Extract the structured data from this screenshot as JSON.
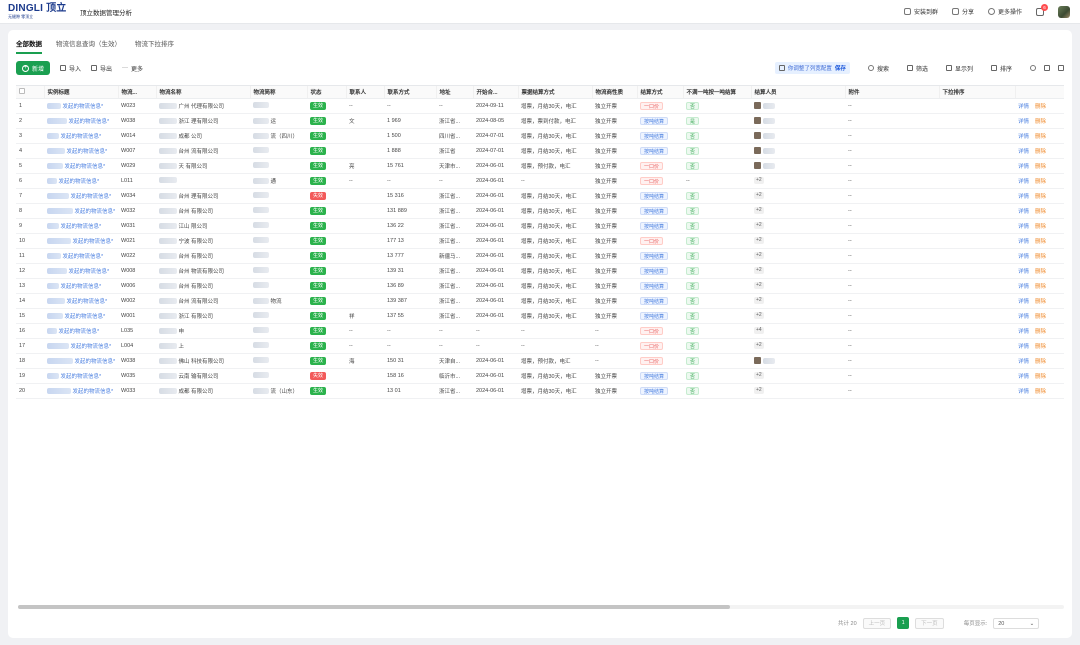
{
  "header": {
    "logo_text": "DINGLI 顶立",
    "logo_sub": "无缝隙  零顶立",
    "app_title": "顶立数据管理分析",
    "actions": [
      {
        "label": "安装到群",
        "icon": "group-install-icon"
      },
      {
        "label": "分享",
        "icon": "share-icon"
      },
      {
        "label": "更多操作",
        "icon": "more-ops-icon"
      }
    ],
    "notification_count": "6"
  },
  "tabs": [
    {
      "label": "全部数据",
      "active": true
    },
    {
      "label": "物流信息查询（生效）",
      "active": false
    },
    {
      "label": "物流下拉排序",
      "active": false
    }
  ],
  "toolbar": {
    "new_label": "新增",
    "import_label": "导入",
    "export_label": "导出",
    "more_label": "更多",
    "tip_text": "你调整了列宽配置",
    "tip_save": "保存",
    "search_label": "搜索",
    "filter_label": "筛选",
    "columns_label": "显示列",
    "sort_label": "排序"
  },
  "columns": [
    "实例标题",
    "物流...",
    "物流名称",
    "物流简称",
    "状态",
    "联系人",
    "联系方式",
    "地址",
    "开始合...",
    "票据结算方式",
    "物流商性质",
    "结算方式",
    "不满一吨按一吨结算",
    "结算人员",
    "附件",
    "下拉排序"
  ],
  "rows": [
    {
      "no": "1",
      "title": "发起的物流信息*",
      "code": "W023",
      "name": "广州  代理有限公司",
      "short": "",
      "status": "生效",
      "contact": "--",
      "phone": "--",
      "addr": "--",
      "start": "2024-09-11",
      "bill": "增票，月结30天，电汇",
      "nature": "独立开票",
      "settle": "一口价",
      "ton": "否",
      "people": "av2",
      "att": "--"
    },
    {
      "no": "2",
      "title": "发起的物流信息*",
      "code": "W038",
      "name": "浙江  理有限公司",
      "short": "运",
      "status": "生效",
      "contact": "文",
      "phone": "1  969",
      "addr": "浙江省...",
      "start": "2024-08-05",
      "bill": "增票，票到付款，电汇",
      "nature": "独立开票",
      "settle": "按吨结算",
      "ton": "是",
      "people": "av2",
      "att": "--"
    },
    {
      "no": "3",
      "title": "发起的物流信息*",
      "code": "W014",
      "name": "成都  公司",
      "short": "流（四川）",
      "status": "生效",
      "contact": "",
      "phone": "1  500",
      "addr": "四川省...",
      "start": "2024-07-01",
      "bill": "增票，月结30天，电汇",
      "nature": "独立开票",
      "settle": "按吨结算",
      "ton": "否",
      "people": "av2",
      "att": "--"
    },
    {
      "no": "4",
      "title": "发起的物流信息*",
      "code": "W007",
      "name": "台州  流有限公司",
      "short": "",
      "status": "生效",
      "contact": "",
      "phone": "1  888",
      "addr": "浙江省",
      "start": "2024-07-01",
      "bill": "增票，月结30天，电汇",
      "nature": "独立开票",
      "settle": "按吨结算",
      "ton": "否",
      "people": "av2",
      "att": "--"
    },
    {
      "no": "5",
      "title": "发起的物流信息*",
      "code": "W029",
      "name": "天  有限公司",
      "short": "",
      "status": "生效",
      "contact": "亮",
      "phone": "15  761",
      "addr": "天津市...",
      "start": "2024-06-01",
      "bill": "增票，预付款，电汇",
      "nature": "独立开票",
      "settle": "一口价",
      "ton": "否",
      "people": "av2",
      "att": "--"
    },
    {
      "no": "6",
      "title": "发起的物流信息*",
      "code": "L011",
      "name": "",
      "short": "通",
      "status": "生效",
      "contact": "--",
      "phone": "--",
      "addr": "--",
      "start": "2024-06-01",
      "bill": "--",
      "nature": "独立开票",
      "settle": "一口价",
      "ton": "--",
      "people": "+2",
      "att": "--"
    },
    {
      "no": "7",
      "title": "发起的物流信息*",
      "code": "W034",
      "name": "台州  理有限公司",
      "short": "",
      "status": "失效",
      "contact": "",
      "phone": "15  316",
      "addr": "浙江省...",
      "start": "2024-06-01",
      "bill": "增票，月结30天，电汇",
      "nature": "独立开票",
      "settle": "按吨结算",
      "ton": "否",
      "people": "+2",
      "att": "--"
    },
    {
      "no": "8",
      "title": "发起的物流信息*",
      "code": "W032",
      "name": "台州  有限公司",
      "short": "",
      "status": "生效",
      "contact": "",
      "phone": "131  889",
      "addr": "浙江省...",
      "start": "2024-06-01",
      "bill": "增票，月结30天，电汇",
      "nature": "独立开票",
      "settle": "按吨结算",
      "ton": "否",
      "people": "+2",
      "att": "--"
    },
    {
      "no": "9",
      "title": "发起的物流信息*",
      "code": "W031",
      "name": "江山  限公司",
      "short": "",
      "status": "生效",
      "contact": "",
      "phone": "136  22",
      "addr": "浙江省...",
      "start": "2024-06-01",
      "bill": "增票，月结30天，电汇",
      "nature": "独立开票",
      "settle": "按吨结算",
      "ton": "否",
      "people": "+2",
      "att": "--"
    },
    {
      "no": "10",
      "title": "发起的物流信息*",
      "code": "W021",
      "name": "宁波  有限公司",
      "short": "",
      "status": "生效",
      "contact": "",
      "phone": "177  13",
      "addr": "浙江省...",
      "start": "2024-06-01",
      "bill": "增票，月结30天，电汇",
      "nature": "独立开票",
      "settle": "一口价",
      "ton": "否",
      "people": "+2",
      "att": "--"
    },
    {
      "no": "11",
      "title": "发起的物流信息*",
      "code": "W022",
      "name": "台州  有限公司",
      "short": "",
      "status": "生效",
      "contact": "",
      "phone": "13  777",
      "addr": "新疆马...",
      "start": "2024-06-01",
      "bill": "增票，月结30天，电汇",
      "nature": "独立开票",
      "settle": "按吨结算",
      "ton": "否",
      "people": "+2",
      "att": "--"
    },
    {
      "no": "12",
      "title": "发起的物流信息*",
      "code": "W008",
      "name": "台州  物流有限公司",
      "short": "",
      "status": "生效",
      "contact": "",
      "phone": "139  31",
      "addr": "浙江省...",
      "start": "2024-06-01",
      "bill": "增票，月结30天，电汇",
      "nature": "独立开票",
      "settle": "按吨结算",
      "ton": "否",
      "people": "+2",
      "att": "--"
    },
    {
      "no": "13",
      "title": "发起的物流信息*",
      "code": "W006",
      "name": "台州  有限公司",
      "short": "",
      "status": "生效",
      "contact": "",
      "phone": "136  89",
      "addr": "浙江省...",
      "start": "2024-06-01",
      "bill": "增票，月结30天，电汇",
      "nature": "独立开票",
      "settle": "按吨结算",
      "ton": "否",
      "people": "+2",
      "att": "--"
    },
    {
      "no": "14",
      "title": "发起的物流信息*",
      "code": "W002",
      "name": "台州  流有限公司",
      "short": "物流",
      "status": "生效",
      "contact": "",
      "phone": "139  387",
      "addr": "浙江省...",
      "start": "2024-06-01",
      "bill": "增票，月结30天，电汇",
      "nature": "独立开票",
      "settle": "按吨结算",
      "ton": "否",
      "people": "+2",
      "att": "--"
    },
    {
      "no": "15",
      "title": "发起的物流信息*",
      "code": "W001",
      "name": "浙江  有限公司",
      "short": "",
      "status": "生效",
      "contact": "祥",
      "phone": "137  55",
      "addr": "浙江省...",
      "start": "2024-06-01",
      "bill": "增票，月结30天，电汇",
      "nature": "独立开票",
      "settle": "按吨结算",
      "ton": "否",
      "people": "+2",
      "att": "--"
    },
    {
      "no": "16",
      "title": "发起的物流信息*",
      "code": "L035",
      "name": "申",
      "short": "",
      "status": "生效",
      "contact": "--",
      "phone": "--",
      "addr": "--",
      "start": "--",
      "bill": "--",
      "nature": "--",
      "settle": "一口价",
      "ton": "否",
      "people": "+4",
      "att": "--"
    },
    {
      "no": "17",
      "title": "发起的物流信息*",
      "code": "L004",
      "name": "上",
      "short": "",
      "status": "生效",
      "contact": "--",
      "phone": "--",
      "addr": "--",
      "start": "--",
      "bill": "--",
      "nature": "--",
      "settle": "一口价",
      "ton": "否",
      "people": "+2",
      "att": "--"
    },
    {
      "no": "18",
      "title": "发起的物流信息*",
      "code": "W038",
      "name": "佛山  科技有限公司",
      "short": "",
      "status": "生效",
      "contact": "海",
      "phone": "150  31",
      "addr": "天津自...",
      "start": "2024-06-01",
      "bill": "增票，预付款，电汇",
      "nature": "--",
      "settle": "一口价",
      "ton": "否",
      "people": "av2",
      "att": "--"
    },
    {
      "no": "19",
      "title": "发起的物流信息*",
      "code": "W035",
      "name": "云南  输有限公司",
      "short": "",
      "status": "失效",
      "contact": "",
      "phone": "158  16",
      "addr": "临沂市...",
      "start": "2024-06-01",
      "bill": "增票，月结30天，电汇",
      "nature": "独立开票",
      "settle": "按吨结算",
      "ton": "否",
      "people": "+2",
      "att": "--"
    },
    {
      "no": "20",
      "title": "发起的物流信息*",
      "code": "W033",
      "name": "成都  有限公司",
      "short": "流（山东）",
      "status": "生效",
      "contact": "",
      "phone": "13  01",
      "addr": "浙江省...",
      "start": "2024-06-01",
      "bill": "增票，月结30天，电汇",
      "nature": "独立开票",
      "settle": "按吨结算",
      "ton": "否",
      "people": "+2",
      "att": "--"
    }
  ],
  "row_actions": {
    "detail": "详情",
    "delete": "删除"
  },
  "pager": {
    "total": "共计 20",
    "prev": "上一页",
    "current": "1",
    "next": "下一页",
    "size_label": "每页显示:",
    "size_value": "20"
  }
}
